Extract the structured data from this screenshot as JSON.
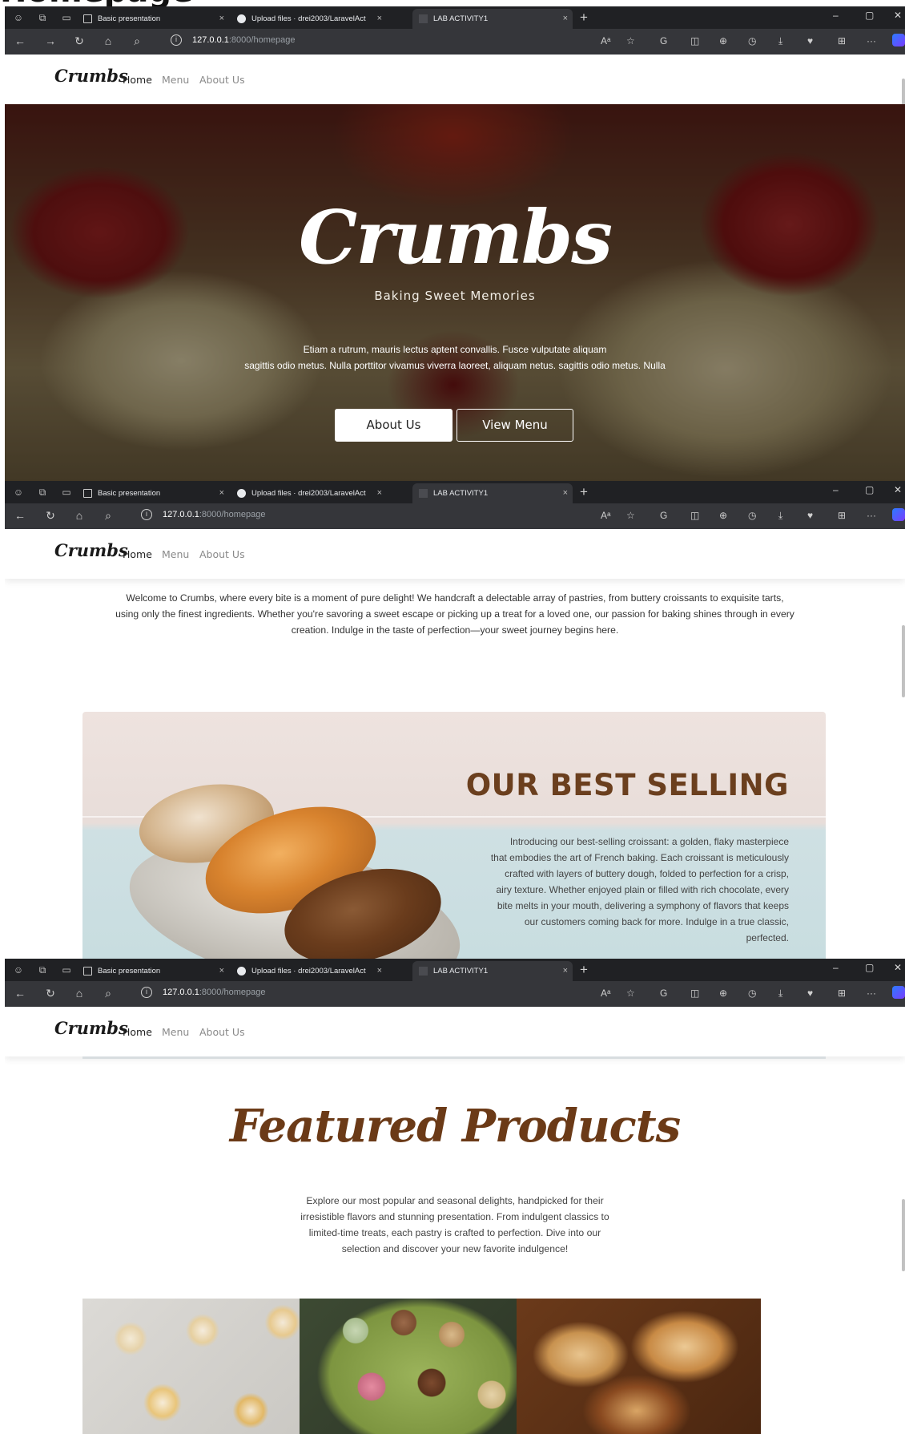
{
  "page_heading": "Homepage",
  "browser": {
    "tabs": [
      {
        "label": "Basic presentation"
      },
      {
        "label": "Upload files · drei2003/LaravelAct"
      },
      {
        "label": "LAB ACTIVITY1"
      }
    ],
    "url_host": "127.0.0.1",
    "url_rest": ":8000/homepage"
  },
  "site": {
    "brand": "Crumbs",
    "nav": [
      "Home",
      "Menu",
      "About Us"
    ]
  },
  "hero": {
    "title": "Crumbs",
    "subtitle": "Baking Sweet Memories",
    "text_line1": "Etiam a rutrum, mauris lectus aptent convallis. Fusce vulputate aliquam",
    "text_line2": "sagittis odio metus. Nulla porttitor vivamus viverra laoreet, aliquam netus. sagittis odio metus. Nulla",
    "btn_about": "About Us",
    "btn_menu": "View Menu"
  },
  "intro": {
    "line1": "Welcome to Crumbs, where every bite is a moment of pure delight! We handcraft a delectable array of pastries, from buttery croissants to exquisite tarts,",
    "line2": "using only the finest ingredients. Whether you're savoring a sweet escape or picking up a treat for a loved one, our passion for baking shines through in every",
    "line3": "creation. Indulge in the taste of perfection—your sweet journey begins here."
  },
  "best_selling": {
    "title": "OUR BEST SELLING",
    "lines": [
      "Introducing our best-selling croissant: a golden, flaky masterpiece",
      "that embodies the art of French baking. Each croissant is meticulously",
      "crafted with layers of buttery dough, folded to perfection for a crisp,",
      "airy texture. Whether enjoyed plain or filled with rich chocolate, every",
      "bite melts in your mouth, delivering a symphony of flavors that keeps",
      "our customers coming back for more. Indulge in a true classic,",
      "perfected."
    ]
  },
  "featured": {
    "title": "Featured Products",
    "lines": [
      "Explore our most popular and seasonal delights, handpicked for their",
      "irresistible flavors and stunning presentation. From indulgent classics to",
      "limited-time treats, each pastry is crafted to perfection. Dive into our",
      "selection and discover your new favorite indulgence!"
    ],
    "products": [
      "cupcakes-image",
      "macarons-image",
      "pastries-image"
    ]
  },
  "colors": {
    "brand_brown": "#6b3a17",
    "browser_dark": "#202124",
    "toolbar_dark": "#35363a"
  }
}
